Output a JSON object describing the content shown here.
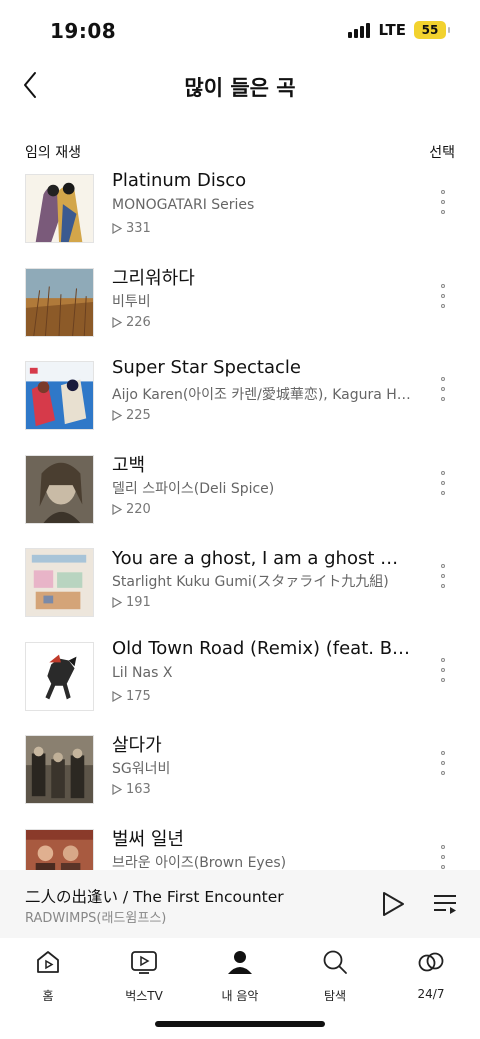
{
  "status_bar": {
    "time": "19:08",
    "network": "LTE",
    "battery": "55"
  },
  "header": {
    "title": "많이 들은 곡"
  },
  "toolbar": {
    "shuffle_label": "임의 재생",
    "select_label": "선택"
  },
  "tracks": [
    {
      "title": "Platinum Disco",
      "artist": "MONOGATARI Series",
      "plays": "331"
    },
    {
      "title": "그리워하다",
      "artist": "비투비",
      "plays": "226"
    },
    {
      "title": "Super Star Spectacle",
      "artist": "Aijo Karen(아이조 카렌/愛城華恋), Kagura H…",
      "plays": "225"
    },
    {
      "title": "고백",
      "artist": "델리 스파이스(Deli Spice)",
      "plays": "220"
    },
    {
      "title": "You are a ghost, I am a ghost ~劇…",
      "artist": "Starlight Kuku Gumi(スタァライト九九組)",
      "plays": "191"
    },
    {
      "title": "Old Town Road (Remix) (feat. Bill…",
      "artist": "Lil Nas X",
      "plays": "175"
    },
    {
      "title": "살다가",
      "artist": "SG워너비",
      "plays": "163"
    },
    {
      "title": "벌써 일년",
      "artist": "브라운 아이즈(Brown Eyes)",
      "plays": ""
    }
  ],
  "mini_player": {
    "title": "二人の出逢い / The First Encounter",
    "artist": "RADWIMPS(래드윔프스)"
  },
  "nav": {
    "home": "홈",
    "bugs_tv": "벅스TV",
    "my_music": "내 음악",
    "explore": "탐색",
    "radio": "24/7"
  },
  "colors": {
    "battery": "#f2d22e",
    "mini_player_bg": "#f6f6f6",
    "secondary_text": "#666666"
  }
}
